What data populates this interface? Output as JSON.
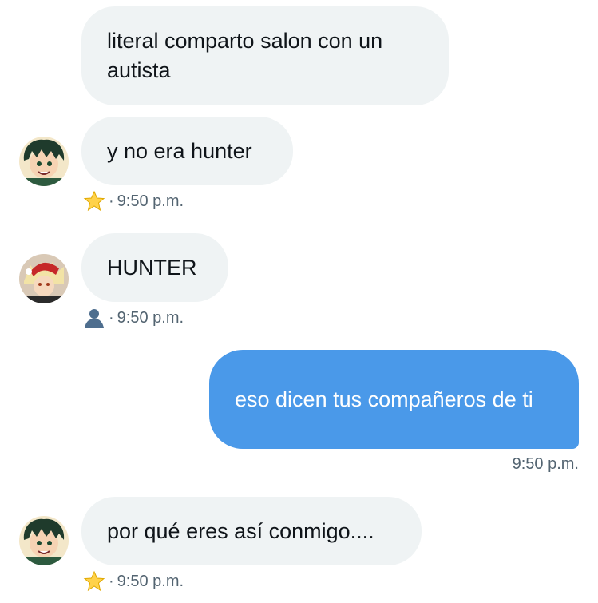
{
  "messages": [
    {
      "direction": "in",
      "text": "literal comparto salon con un autista"
    },
    {
      "direction": "in",
      "text": "y no era hunter",
      "sender_icon": "star-emoji",
      "time": "9:50 p.m."
    },
    {
      "direction": "in",
      "text": "HUNTER",
      "sender_icon": "bust-silhouette-emoji",
      "time": "9:50 p.m."
    },
    {
      "direction": "out",
      "text": "eso dicen tus compañeros de ti",
      "time": "9:50 p.m."
    },
    {
      "direction": "in",
      "text": "por qué eres así conmigo....",
      "sender_icon": "star-emoji",
      "time": "9:50 p.m."
    }
  ],
  "meta_separator": "·",
  "colors": {
    "incoming_bubble": "#eff3f4",
    "outgoing_bubble": "#4a99e9",
    "meta_text": "#536471"
  }
}
